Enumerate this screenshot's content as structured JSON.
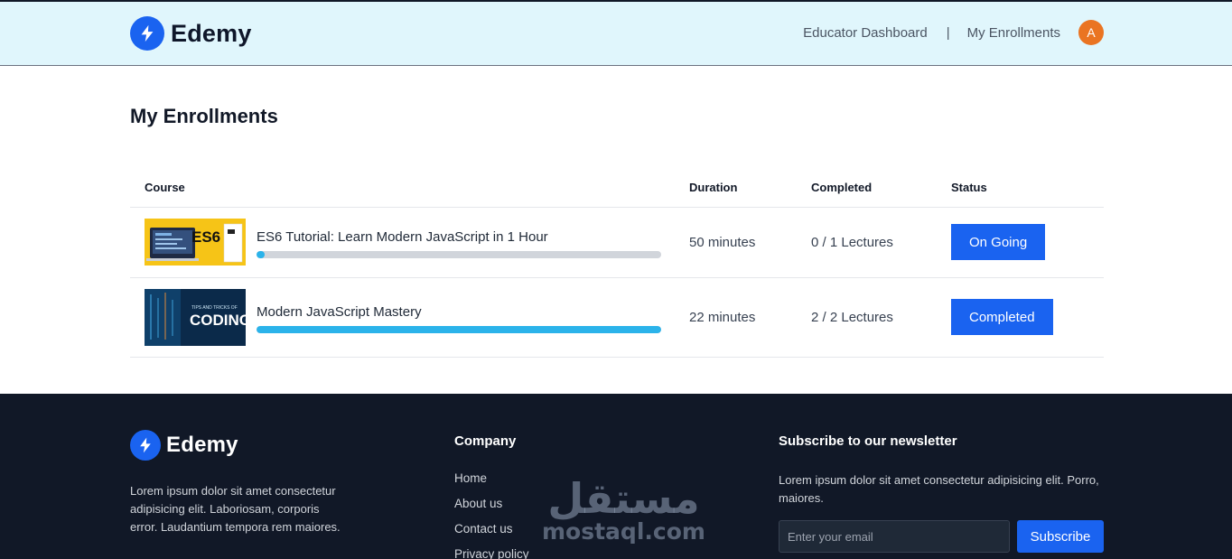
{
  "header": {
    "brand": "Edemy",
    "nav": {
      "educator": "Educator Dashboard",
      "separator": "|",
      "enrollments": "My Enrollments"
    },
    "avatar_initial": "A"
  },
  "page_title": "My Enrollments",
  "table": {
    "headers": {
      "course": "Course",
      "duration": "Duration",
      "completed": "Completed",
      "status": "Status"
    },
    "rows": [
      {
        "title": "ES6 Tutorial: Learn Modern JavaScript in 1 Hour",
        "progress": 0.02,
        "duration": "50 minutes",
        "completed": "0 / 1 Lectures",
        "status": "On Going",
        "thumb_text": "ES6"
      },
      {
        "title": "Modern JavaScript Mastery",
        "progress": 1.0,
        "duration": "22 minutes",
        "completed": "2 / 2 Lectures",
        "status": "Completed",
        "thumb_text": "CODING",
        "thumb_subtext": "TIPS AND TRICKS OF"
      }
    ]
  },
  "footer": {
    "brand": "Edemy",
    "description": "Lorem ipsum dolor sit amet consectetur adipisicing elit. Laboriosam, corporis error. Laudantium tempora rem maiores.",
    "company_heading": "Company",
    "links": [
      "Home",
      "About us",
      "Contact us",
      "Privacy policy"
    ],
    "newsletter_heading": "Subscribe to our newsletter",
    "newsletter_text": "Lorem ipsum dolor sit amet consectetur adipisicing elit. Porro, maiores.",
    "email_placeholder": "Enter your email",
    "subscribe_label": "Subscribe"
  },
  "watermark": {
    "arabic": "مستقل",
    "latin": "mostaql.com"
  },
  "colors": {
    "primary": "#1a63f0",
    "header_bg": "#e0f6fc",
    "footer_bg": "#111827",
    "progress": "#2bb3ea",
    "avatar": "#ea7422"
  },
  "icons": {
    "brand": "lightning-bolt-icon"
  }
}
